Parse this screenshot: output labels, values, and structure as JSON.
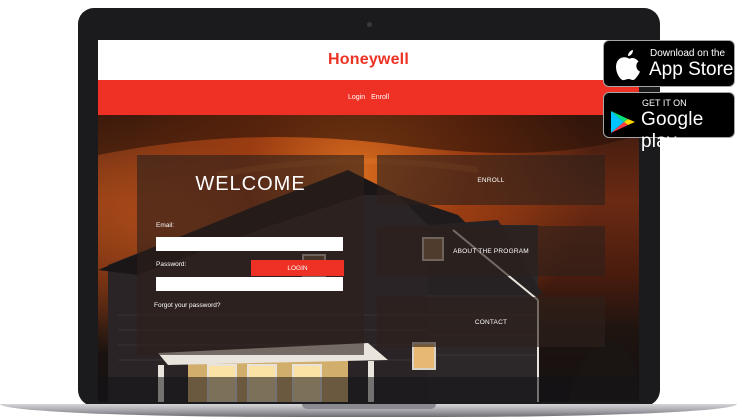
{
  "site": {
    "brand": "Honeywell",
    "nav": [
      "Login",
      "Enroll"
    ]
  },
  "login_panel": {
    "title": "WELCOME",
    "email_label": "Email:",
    "email_value": "",
    "password_label": "Password:",
    "password_value": "",
    "forgot_label": "Forgot your password?",
    "login_label": "LOGIN"
  },
  "side_panels": [
    "ENROLL",
    "ABOUT THE PROGRAM",
    "CONTACT"
  ],
  "badges": {
    "apple_small": "Download on the",
    "apple_big": "App Store",
    "google_small": "GET IT ON",
    "google_big": "Google play"
  },
  "colors": {
    "brand_red": "#ee3124",
    "badge_bg": "#000000"
  },
  "icons": [
    "apple-icon",
    "google-play-icon"
  ]
}
